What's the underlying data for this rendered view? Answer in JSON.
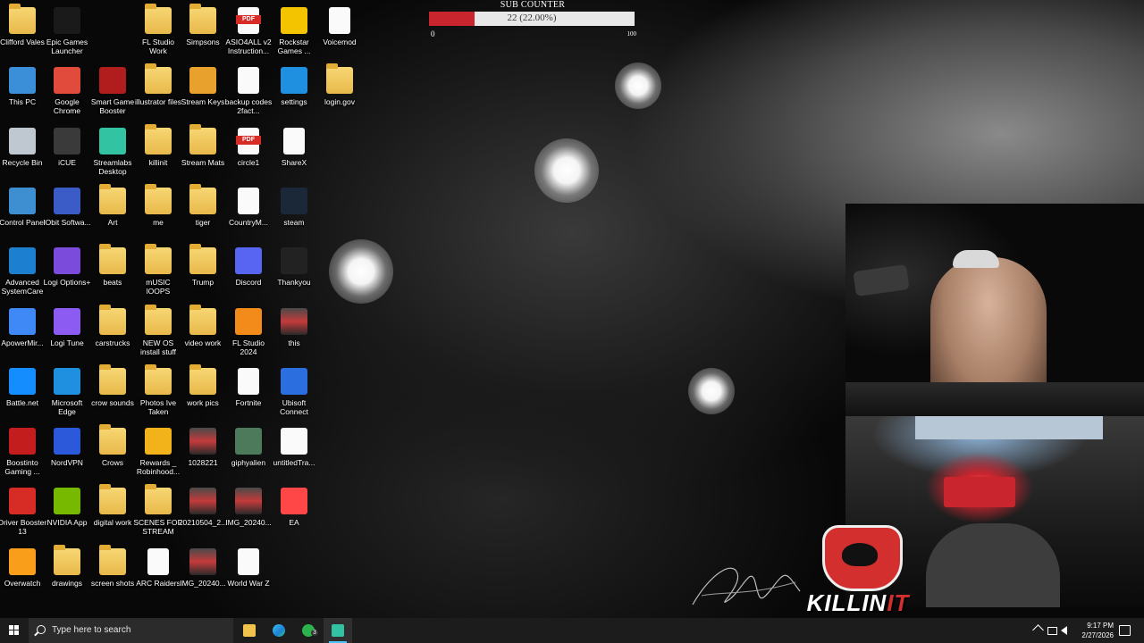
{
  "desktop": {
    "icons": [
      {
        "label": "Clifford Vales",
        "icon": "folder-icon"
      },
      {
        "label": "Epic Games Launcher",
        "icon": "epic-games-icon"
      },
      {
        "label": "FL Studio Work",
        "icon": "folder-icon"
      },
      {
        "label": "Simpsons",
        "icon": "folder-icon"
      },
      {
        "label": "ASIO4ALL v2 Instruction...",
        "icon": "pdf-icon"
      },
      {
        "label": "Rockstar Games ...",
        "icon": "rockstar-icon"
      },
      {
        "label": "Voicemod",
        "icon": "file-icon"
      },
      {
        "label": "This PC",
        "icon": "computer-icon"
      },
      {
        "label": "Google Chrome",
        "icon": "chrome-icon"
      },
      {
        "label": "Smart Game Booster",
        "icon": "game-booster-icon"
      },
      {
        "label": "illustrator files",
        "icon": "folder-icon"
      },
      {
        "label": "Stream Keys",
        "icon": "key-icon"
      },
      {
        "label": "backup codes 2fact...",
        "icon": "file-icon"
      },
      {
        "label": "settings",
        "icon": "edge-icon"
      },
      {
        "label": "login.gov",
        "icon": "folder-icon"
      },
      {
        "label": "Recycle Bin",
        "icon": "recycle-bin-icon"
      },
      {
        "label": "iCUE",
        "icon": "icue-icon"
      },
      {
        "label": "Streamlabs Desktop",
        "icon": "streamlabs-icon"
      },
      {
        "label": "killinit",
        "icon": "folder-icon"
      },
      {
        "label": "Stream Mats",
        "icon": "folder-icon"
      },
      {
        "label": "circle1",
        "icon": "pdf-icon"
      },
      {
        "label": "ShareX",
        "icon": "file-icon"
      },
      {
        "label": "Control Panel",
        "icon": "control-panel-icon"
      },
      {
        "label": "IObit Softwa...",
        "icon": "iobit-icon"
      },
      {
        "label": "Art",
        "icon": "folder-icon"
      },
      {
        "label": "me",
        "icon": "folder-icon"
      },
      {
        "label": "tiger",
        "icon": "folder-icon"
      },
      {
        "label": "CountryM...",
        "icon": "file-icon"
      },
      {
        "label": "steam",
        "icon": "steam-icon"
      },
      {
        "label": "Advanced SystemCare",
        "icon": "systemcare-icon"
      },
      {
        "label": "Logi Options+",
        "icon": "logi-options-icon"
      },
      {
        "label": "beats",
        "icon": "folder-icon"
      },
      {
        "label": "mUSIC lOOPS",
        "icon": "folder-icon"
      },
      {
        "label": "Trump",
        "icon": "folder-icon"
      },
      {
        "label": "Discord",
        "icon": "discord-icon"
      },
      {
        "label": "Thankyou",
        "icon": "thankyou-image-icon"
      },
      {
        "label": "ApowerMir...",
        "icon": "apowermirror-icon"
      },
      {
        "label": "Logi Tune",
        "icon": "logi-tune-icon"
      },
      {
        "label": "carstrucks",
        "icon": "folder-icon"
      },
      {
        "label": "NEW OS install stuff",
        "icon": "folder-icon"
      },
      {
        "label": "video work",
        "icon": "folder-icon"
      },
      {
        "label": "FL Studio 2024",
        "icon": "fl-studio-icon"
      },
      {
        "label": "this",
        "icon": "image-icon"
      },
      {
        "label": "Battle.net",
        "icon": "battlenet-icon"
      },
      {
        "label": "Microsoft Edge",
        "icon": "edge-icon"
      },
      {
        "label": "crow sounds",
        "icon": "folder-icon"
      },
      {
        "label": "Photos Ive Taken",
        "icon": "folder-icon"
      },
      {
        "label": "work pics",
        "icon": "folder-icon"
      },
      {
        "label": "Fortnite",
        "icon": "file-icon"
      },
      {
        "label": "Ubisoft Connect",
        "icon": "ubisoft-icon"
      },
      {
        "label": "Boostinto Gaming ...",
        "icon": "boost-icon"
      },
      {
        "label": "NordVPN",
        "icon": "nordvpn-icon"
      },
      {
        "label": "Crows",
        "icon": "folder-icon"
      },
      {
        "label": "Rewards _ Robinhood...",
        "icon": "star-icon"
      },
      {
        "label": "1028221",
        "icon": "image-icon"
      },
      {
        "label": "giphyalien",
        "icon": "alien-image-icon"
      },
      {
        "label": "untitledTra...",
        "icon": "video-file-icon"
      },
      {
        "label": "Driver Booster 13",
        "icon": "driver-booster-icon"
      },
      {
        "label": "NVIDIA App",
        "icon": "nvidia-icon"
      },
      {
        "label": "digital work",
        "icon": "folder-icon"
      },
      {
        "label": "SCENES FOR STREAM",
        "icon": "folder-icon"
      },
      {
        "label": "20210504_2...",
        "icon": "image-icon"
      },
      {
        "label": "IMG_20240...",
        "icon": "image-icon"
      },
      {
        "label": "EA",
        "icon": "ea-icon"
      },
      {
        "label": "Overwatch",
        "icon": "overwatch-icon"
      },
      {
        "label": "drawings",
        "icon": "folder-icon"
      },
      {
        "label": "screen shots",
        "icon": "folder-icon"
      },
      {
        "label": "ARC Raiders",
        "icon": "file-icon"
      },
      {
        "label": "IMG_20240...",
        "icon": "image-icon"
      },
      {
        "label": "World War Z",
        "icon": "file-icon"
      }
    ]
  },
  "sub_counter": {
    "title": "SUB COUNTER",
    "value_text": "22 (22.00%)",
    "progress_fraction": 0.22,
    "min_label": "0",
    "max_label": "100",
    "fill_color": "#c9252f"
  },
  "overlay": {
    "logo_text_a": "KILLIN",
    "logo_text_b": "IT"
  },
  "taskbar": {
    "search_placeholder": "Type here to search",
    "apps": [
      "file-explorer-icon",
      "edge-icon",
      "xbox-icon",
      "streamlabs-icon"
    ],
    "xbox_badge": "3",
    "time": "9:17 PM",
    "date": "2/27/2026"
  }
}
